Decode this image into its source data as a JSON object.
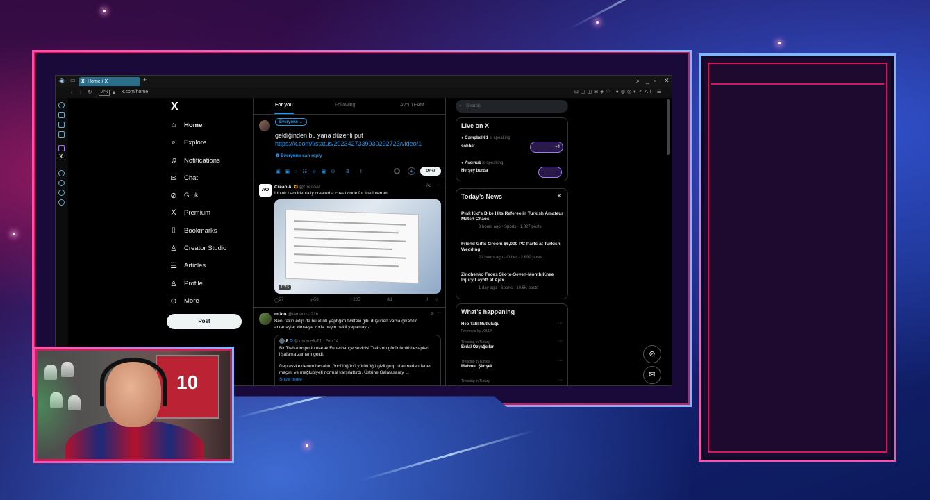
{
  "browser": {
    "tab_title": "Home / X",
    "url": "x.com/home",
    "vpn_label": "VPN",
    "ext_label": "AI"
  },
  "nav": {
    "logo": "X",
    "items": [
      {
        "label": "Home",
        "icon": "home-icon",
        "glyph": "⌂"
      },
      {
        "label": "Explore",
        "icon": "search-icon",
        "glyph": "⌕"
      },
      {
        "label": "Notifications",
        "icon": "bell-icon",
        "glyph": "♫"
      },
      {
        "label": "Chat",
        "icon": "mail-icon",
        "glyph": "✉"
      },
      {
        "label": "Grok",
        "icon": "grok-icon",
        "glyph": "⊘"
      },
      {
        "label": "Premium",
        "icon": "x-icon",
        "glyph": "X"
      },
      {
        "label": "Bookmarks",
        "icon": "bookmark-icon",
        "glyph": "⌷"
      },
      {
        "label": "Creator Studio",
        "icon": "creator-icon",
        "glyph": "♙"
      },
      {
        "label": "Articles",
        "icon": "articles-icon",
        "glyph": "☰"
      },
      {
        "label": "Profile",
        "icon": "profile-icon",
        "glyph": "♙"
      },
      {
        "label": "More",
        "icon": "more-icon",
        "glyph": "⊙"
      }
    ],
    "post_button": "Post"
  },
  "timeline": {
    "tabs": [
      "For you",
      "Following",
      "Avcı TEAM"
    ],
    "composer": {
      "audience": "Everyone ⌄",
      "line1": "geldiğinden bu yana düzenli put",
      "line2": "https://x.com/i/status/2023427339930292723/video/1",
      "reply_setting": "Everyone can reply",
      "post_label": "Post",
      "tools": "▣▣◌☷☺▣⊙ B I"
    },
    "tweets": [
      {
        "name": "Creao AI",
        "handle": "@CreaoAI",
        "ad": "Ad",
        "text": "I think I accidentally created a cheat code for the internet.",
        "duration": "1:23",
        "replies": "27",
        "reposts": "58",
        "likes": "235",
        "views": "1"
      },
      {
        "name": "müco",
        "handle": "@lamuco · 21h",
        "text": "Beni takip edip de bu alıntı yapbğım twitteki gibi düşünen varsa çıkabilir arkadaşlar kimseye zorla beyin nakil yapamayız",
        "quote_handle": "@toscanelio61 · Feb 14",
        "quote_text1": "Bir Trabzonsporlu olarak Fenerbahçe sevicisi Trabzon görünümlü hesapları ifşalama zamanı geldi.",
        "quote_text2": "Deplasske denen hesabın öncülüğünü yürüttüğü gizli grup utanmadan fener maçını ve mağlubiyeti normal karşılattırdı. Üstüne Galatasaray ...",
        "show_more": "Show more"
      }
    ]
  },
  "right": {
    "search_placeholder": "Search",
    "live": {
      "title": "Live on X",
      "items": [
        {
          "host": "Campbell61",
          "status": "is speaking",
          "topic": "sohbet",
          "extra": "+4"
        },
        {
          "host": "Avcıhub",
          "status": "is speaking",
          "topic": "Herşey burda"
        }
      ]
    },
    "news": {
      "title": "Today’s News",
      "close": "×",
      "items": [
        {
          "headline": "Pink Kid's Bike Hits Referee in Turkish Amateur Match Chaos",
          "meta": "3 hours ago · Sports · 1,827 posts"
        },
        {
          "headline": "Friend Gifts Groom $6,000 PC Parts at Turkish Wedding",
          "meta": "21 hours ago · Other · 2,692 posts"
        },
        {
          "headline": "Zinchenko Faces Six-to-Seven-Month Knee Injury Layoff at Ajax",
          "meta": "1 day ago · Sports · 10.6K posts"
        }
      ]
    },
    "happening": {
      "title": "What’s happening",
      "items": [
        {
          "context": "",
          "topic": "Hep Tatil Mutluluğu",
          "sub": "Promoted by JOLLY"
        },
        {
          "context": "Trending in Turkey",
          "topic": "Erdal Özyağcılar",
          "sub": ""
        },
        {
          "context": "Trending in Turkey",
          "topic": "Mehmet Şimşek",
          "sub": ""
        },
        {
          "context": "Trending in Turkey",
          "topic": "",
          "sub": ""
        }
      ]
    }
  },
  "webcam": {
    "jersey_number": "10"
  },
  "colors": {
    "accent": "#1d9bf0",
    "frame_pink": "#ff4fa8",
    "frame_red": "#d21a5a",
    "frame_blue": "#7fb8ff"
  }
}
